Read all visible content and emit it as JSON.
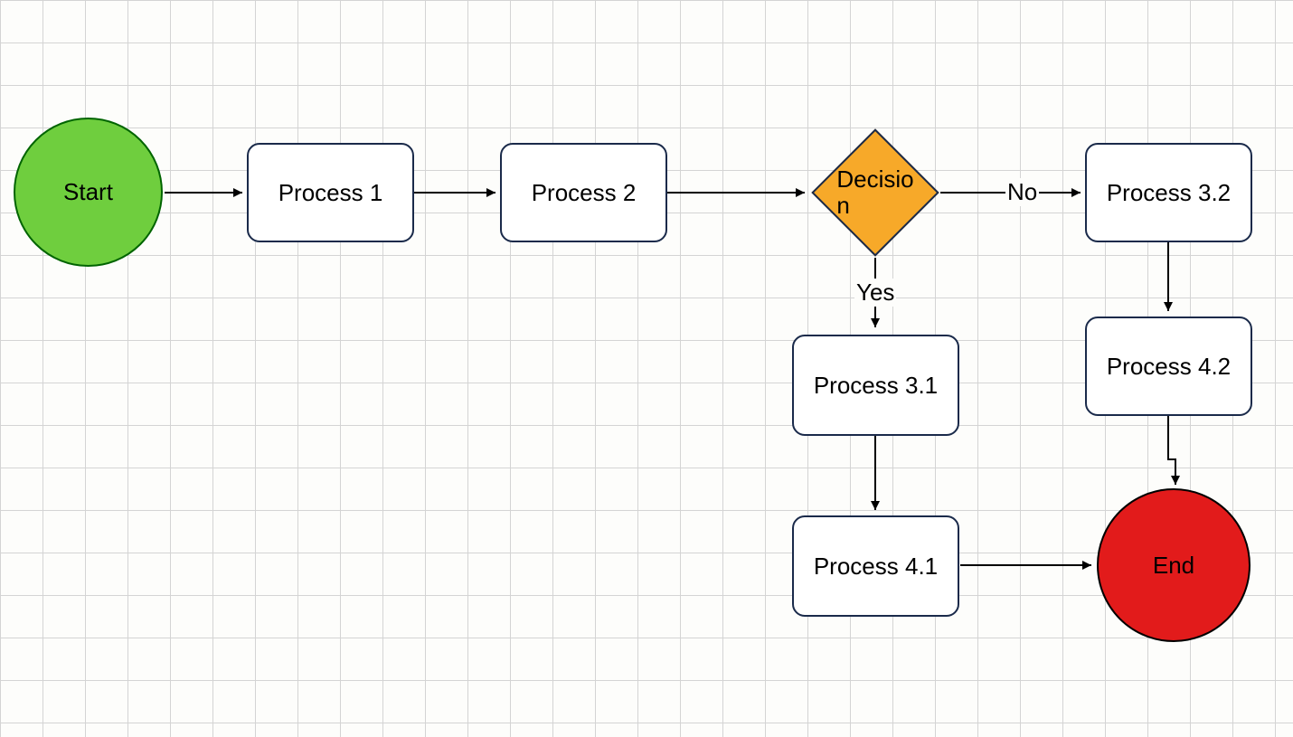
{
  "nodes": {
    "start": {
      "label": "Start"
    },
    "p1": {
      "label": "Process 1"
    },
    "p2": {
      "label": "Process 2"
    },
    "decision": {
      "label": "Decisio\nn"
    },
    "p31": {
      "label": "Process 3.1"
    },
    "p32": {
      "label": "Process 3.2"
    },
    "p41": {
      "label": "Process 4.1"
    },
    "p42": {
      "label": "Process 4.2"
    },
    "end": {
      "label": "End"
    }
  },
  "edges": {
    "yes": {
      "label": "Yes"
    },
    "no": {
      "label": "No"
    }
  }
}
